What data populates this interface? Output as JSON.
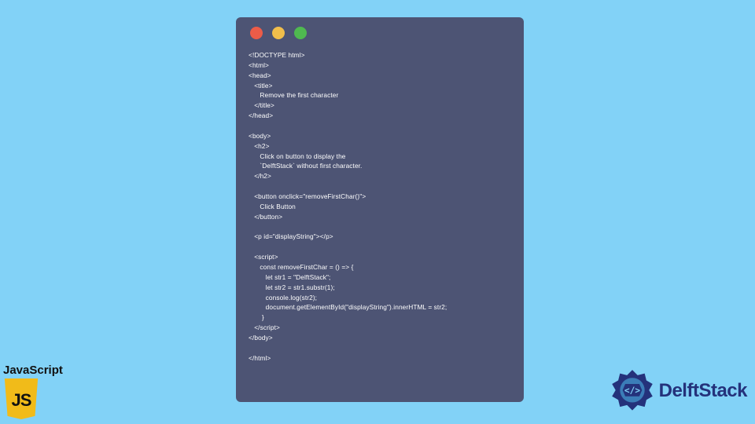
{
  "window": {
    "dots": [
      "red",
      "yellow",
      "green"
    ]
  },
  "code": {
    "lines": [
      "<!DOCTYPE html>",
      "<html>",
      "<head>",
      "   <title>",
      "      Remove the first character",
      "   </title>",
      "</head>",
      "",
      "<body>",
      "   <h2>",
      "      Click on button to display the",
      "      `DelftStack` without first character.",
      "   </h2>",
      "",
      "   <button onclick=\"removeFirstChar()\">",
      "      Click Button",
      "   </button>",
      "",
      "   <p id=\"displayString\"></p>",
      "",
      "   <script>",
      "      const removeFirstChar = () => {",
      "         let str1 = \"DelftStack\";",
      "         let str2 = str1.substr(1);",
      "         console.log(str2);",
      "         document.getElementById(\"displayString\").innerHTML = str2;",
      "       }",
      "   </script>",
      "</body>",
      "",
      "</html>"
    ]
  },
  "badges": {
    "js_label": "JavaScript",
    "js_icon_text": "JS",
    "delft_text": "DelftStack"
  },
  "colors": {
    "bg": "#82d2f7",
    "window": "#4d5474",
    "js": "#f1bb19",
    "delft": "#24327b"
  }
}
